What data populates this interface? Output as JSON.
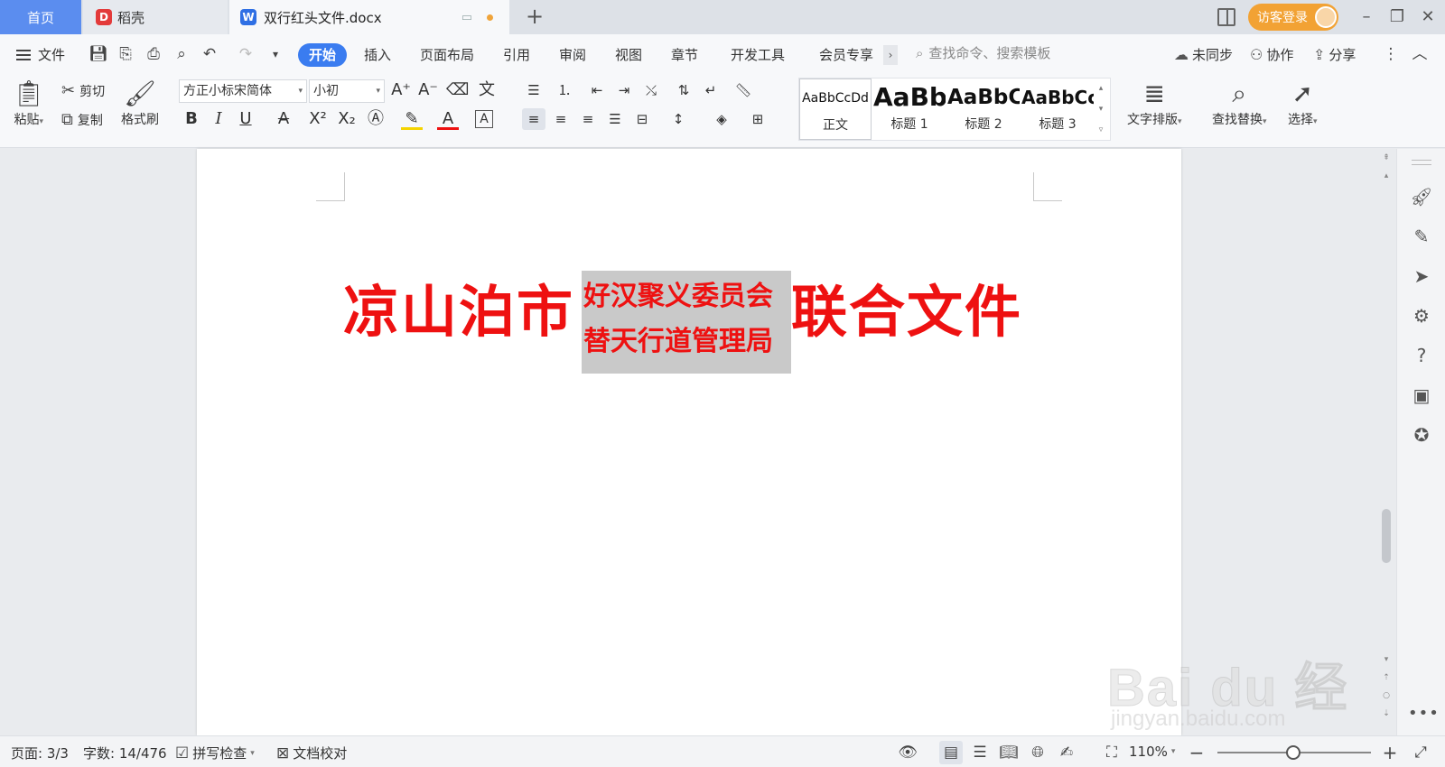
{
  "tabs": {
    "home": "首页",
    "daoke": "稻壳",
    "doc": "双行红头文件.docx",
    "add": "+"
  },
  "account": {
    "visitor_login": "访客登录"
  },
  "window": {
    "minimize": "–",
    "restore": "❐",
    "close": "✕"
  },
  "menu": {
    "file": "文件",
    "items": [
      "开始",
      "插入",
      "页面布局",
      "引用",
      "审阅",
      "视图",
      "章节",
      "开发工具",
      "会员专享"
    ],
    "active": "开始",
    "more": "›",
    "search_placeholder": "查找命令、搜索模板",
    "unsynced": "未同步",
    "collaborate": "协作",
    "share": "分享"
  },
  "ribbon": {
    "paste": "粘贴",
    "cut": "剪切",
    "copy": "复制",
    "format_painter": "格式刷",
    "font_name": "方正小标宋简体",
    "font_size": "小初",
    "styles": [
      {
        "preview": "AaBbCcDd",
        "name": "正文"
      },
      {
        "preview": "AaBb",
        "name": "标题 1"
      },
      {
        "preview": "AaBbC",
        "name": "标题 2"
      },
      {
        "preview": "AaBbCc",
        "name": "标题 3"
      }
    ],
    "text_layout": "文字排版",
    "find_replace": "查找替换",
    "select": "选择"
  },
  "document": {
    "left_text": "凉山泊市",
    "stack_line_1": "好汉聚义委员会",
    "stack_line_2": "替天行道管理局",
    "right_text": "联合文件"
  },
  "status": {
    "page": "页面: 3/3",
    "word_count": "字数: 14/476",
    "spell_check": "拼写检查",
    "doc_proof": "文档校对",
    "zoom": "110%"
  },
  "watermark": {
    "main": "Bai du 经验",
    "sub": "jingyan.baidu.com"
  },
  "colors": {
    "accent": "#3a7cf0",
    "heading_red": "#ee1111",
    "visitor": "#f2a234",
    "home_tab": "#5b8def"
  }
}
